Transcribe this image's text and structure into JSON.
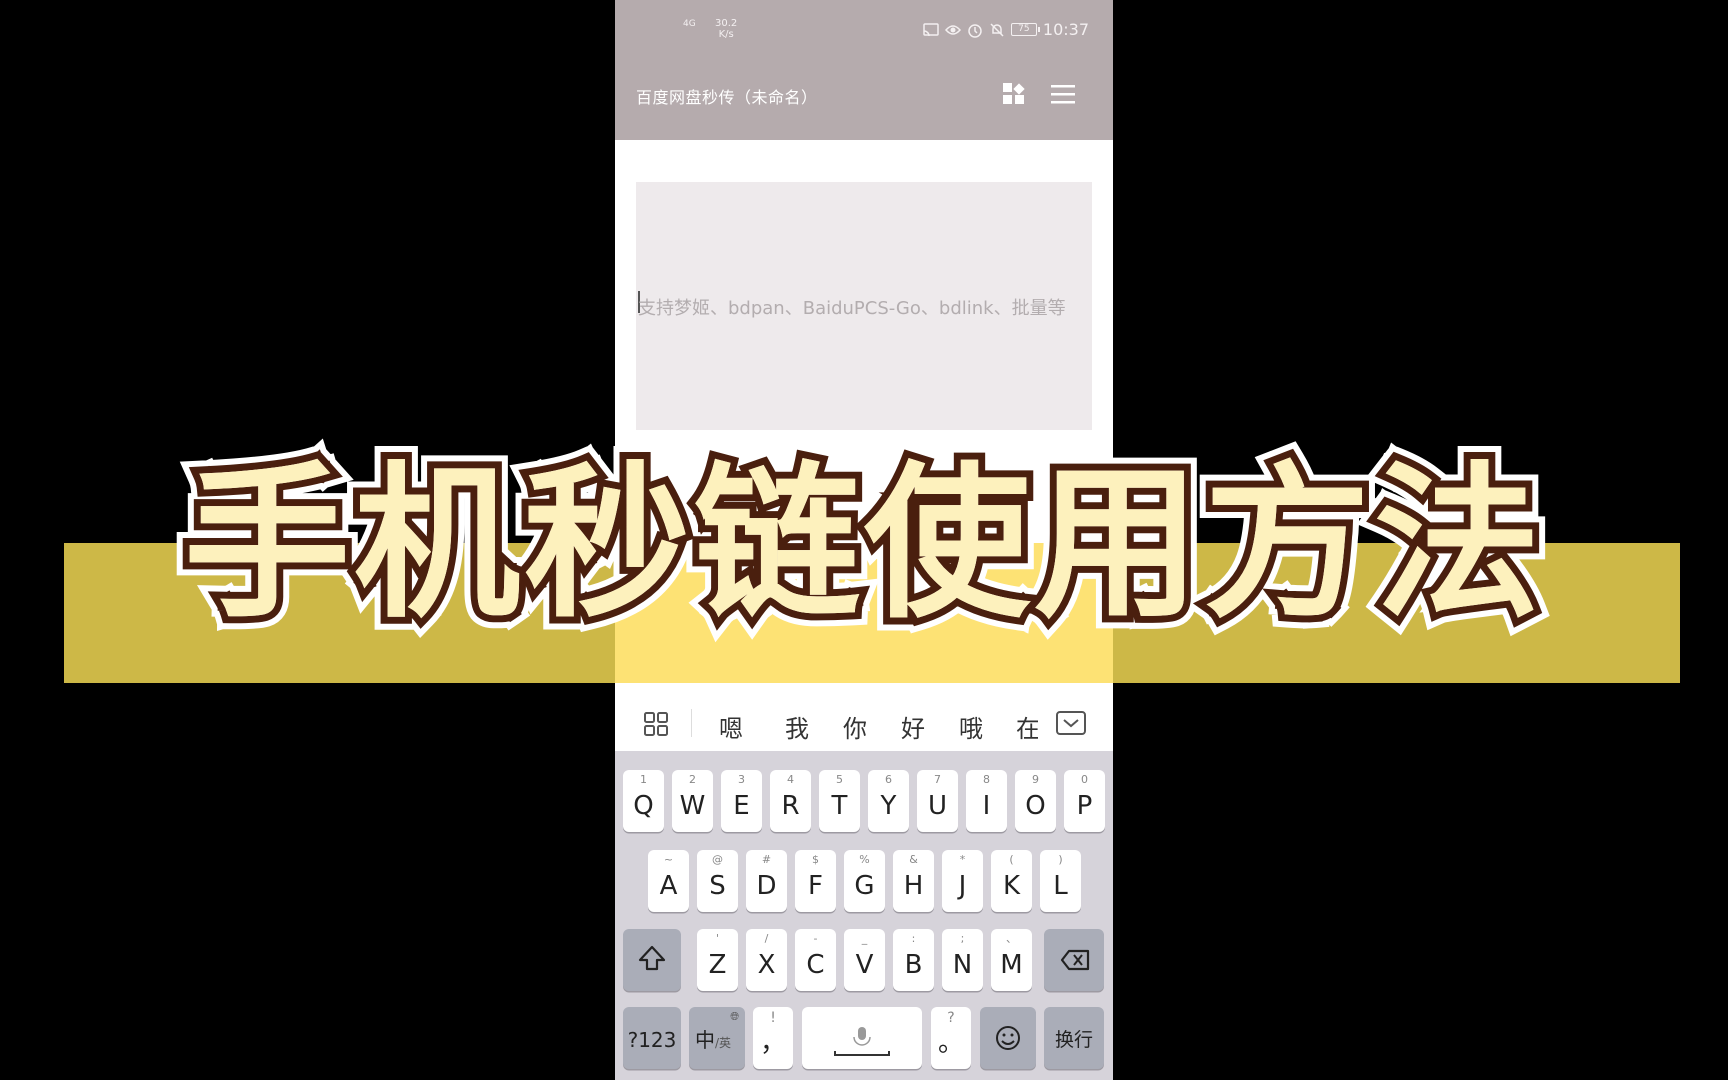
{
  "status_bar": {
    "network": "4G",
    "speed_value": "30.2",
    "speed_unit": "K/s",
    "battery": "75",
    "time": "10:37",
    "icons": [
      "cast-icon",
      "eye-icon",
      "alarm-icon",
      "mute-icon"
    ]
  },
  "app_bar": {
    "title": "百度网盘秒传（未命名）",
    "actions": [
      "grid-add-icon",
      "menu-icon"
    ]
  },
  "input": {
    "placeholder": "支持梦姬、bdpan、BaiduPCS-Go、bdlink、批量等"
  },
  "keyboard": {
    "suggestions": [
      "嗯",
      "我",
      "你",
      "好",
      "哦",
      "在"
    ],
    "row1": [
      {
        "sub": "1",
        "main": "Q"
      },
      {
        "sub": "2",
        "main": "W"
      },
      {
        "sub": "3",
        "main": "E"
      },
      {
        "sub": "4",
        "main": "R"
      },
      {
        "sub": "5",
        "main": "T"
      },
      {
        "sub": "6",
        "main": "Y"
      },
      {
        "sub": "7",
        "main": "U"
      },
      {
        "sub": "8",
        "main": "I"
      },
      {
        "sub": "9",
        "main": "O"
      },
      {
        "sub": "0",
        "main": "P"
      }
    ],
    "row2": [
      {
        "sub": "~",
        "main": "A"
      },
      {
        "sub": "@",
        "main": "S"
      },
      {
        "sub": "#",
        "main": "D"
      },
      {
        "sub": "$",
        "main": "F"
      },
      {
        "sub": "%",
        "main": "G"
      },
      {
        "sub": "&",
        "main": "H"
      },
      {
        "sub": "*",
        "main": "J"
      },
      {
        "sub": "(",
        "main": "K"
      },
      {
        "sub": ")",
        "main": "L"
      }
    ],
    "row3": [
      {
        "sub": "'",
        "main": "Z"
      },
      {
        "sub": "/",
        "main": "X"
      },
      {
        "sub": "-",
        "main": "C"
      },
      {
        "sub": "_",
        "main": "V"
      },
      {
        "sub": ":",
        "main": "B"
      },
      {
        "sub": ";",
        "main": "N"
      },
      {
        "sub": "、",
        "main": "M"
      }
    ],
    "numbers_key": "?123",
    "lang_key": "中",
    "lang_key_alt": "/英",
    "comma_sub": "!",
    "comma_main": "，",
    "period_sub": "?",
    "period_main": "。",
    "enter_key": "换行"
  },
  "overlay": {
    "title": "手机秒链使用方法"
  },
  "colors": {
    "app_bar": "#b5abad",
    "band": "#cdb847",
    "band_center": "#fde274",
    "title_fill": "#fdf1bd",
    "title_stroke": "#4a1f0e"
  }
}
